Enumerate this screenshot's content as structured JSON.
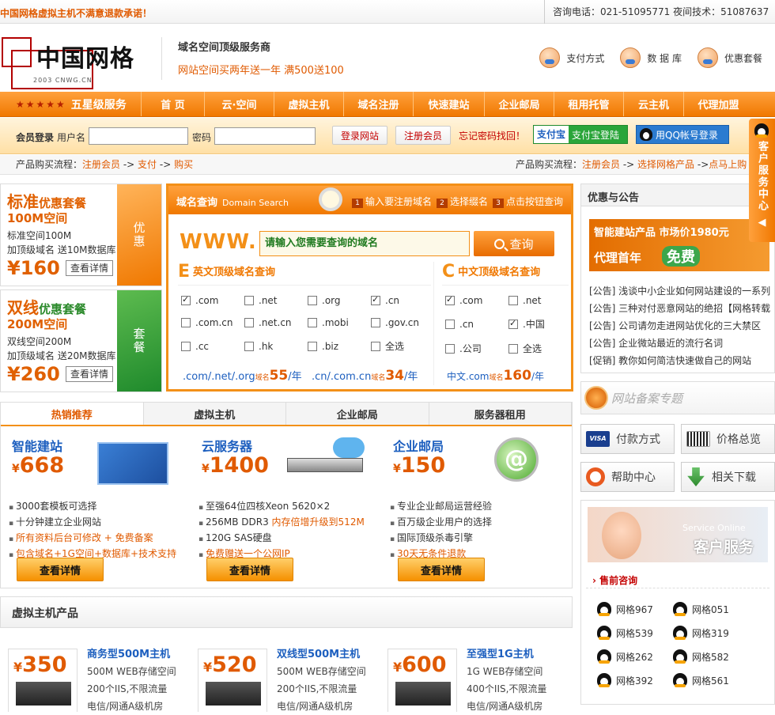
{
  "topbar": {
    "promo": "中国网格虚拟主机不满意退款承诺！",
    "phones": "咨询电话：021-51095771 夜间技术：51087637"
  },
  "logo": {
    "name": "中国网格",
    "sub": "2003 CNWG.CN"
  },
  "slogan": {
    "title": "域名空间顶级服务商",
    "promo": "网站空间买两年送一年 满500送100"
  },
  "quick_links": [
    "支付方式",
    "数 据 库",
    "优惠套餐"
  ],
  "nav": {
    "first": "五星级服务",
    "items": [
      "首 页",
      "云·空间",
      "虚拟主机",
      "域名注册",
      "快速建站",
      "企业邮局",
      "租用托管",
      "云主机",
      "代理加盟"
    ]
  },
  "login": {
    "title": "会员登录",
    "user_label": "用户名",
    "pass_label": "密码",
    "login_btn": "登录网站",
    "register_btn": "注册会员",
    "forget": "忘记密码找回！",
    "alipay_logo": "支付宝",
    "alipay": "支付宝登陆",
    "qq": "用QQ帐号登录"
  },
  "flow": {
    "label": "产品购买流程：",
    "left": [
      "注册会员",
      "支付",
      "购买"
    ],
    "right": [
      "注册会员",
      "选择网格产品",
      "点马上购"
    ]
  },
  "packages": [
    {
      "title": "标准",
      "title_small": "优惠套餐",
      "size": "100M空间",
      "l1": "标准空间100M",
      "l2": "加顶级域名 送10M数据库",
      "price": "¥160",
      "btn": "查看详情",
      "side": "优惠"
    },
    {
      "title": "双线",
      "title_small": "优惠套餐",
      "size": "200M空间",
      "l1": "双线空间200M",
      "l2": "加顶级域名 送20M数据库",
      "price": "¥260",
      "btn": "查看详情",
      "side": "套餐"
    }
  ],
  "domain": {
    "title": "域名查询",
    "title_en": "Domain Search",
    "steps": [
      "输入要注册域名",
      "选择缀名",
      "点击按钮查询"
    ],
    "www": "WWW.",
    "placeholder": "请输入您需要查询的域名",
    "search_btn": "查询",
    "en_big": "E",
    "en_title": "英文顶级域名查询",
    "cn_big": "C",
    "cn_title": "中文顶级域名查询",
    "en_options": [
      {
        "label": ".com",
        "checked": true
      },
      {
        "label": ".net",
        "checked": false
      },
      {
        "label": ".org",
        "checked": false
      },
      {
        "label": ".cn",
        "checked": true
      },
      {
        "label": ".com.cn",
        "checked": false
      },
      {
        "label": ".net.cn",
        "checked": false
      },
      {
        "label": ".mobi",
        "checked": false
      },
      {
        "label": ".gov.cn",
        "checked": false
      },
      {
        "label": ".cc",
        "checked": false
      },
      {
        "label": ".hk",
        "checked": false
      },
      {
        "label": ".biz",
        "checked": false
      },
      {
        "label": "全选",
        "checked": false
      }
    ],
    "cn_options": [
      {
        "label": ".com",
        "checked": true
      },
      {
        "label": ".net",
        "checked": false
      },
      {
        "label": ".cn",
        "checked": false
      },
      {
        "label": ".中国",
        "checked": true
      },
      {
        "label": ".公司",
        "checked": false
      },
      {
        "label": "全选",
        "checked": false
      }
    ],
    "price1_pre": ".com/.net/.org",
    "price1_sfx": "域名",
    "price1": "55",
    "price1_unit": "/年",
    "price2_pre": ".cn/.com.cn",
    "price2_sfx": "域名",
    "price2": "34",
    "price2_unit": "/年",
    "price3_pre": "中文.com",
    "price3_sfx": "域名",
    "price3": "160",
    "price3_unit": "/年"
  },
  "notice": {
    "title": "优惠与公告",
    "banner1": "智能建站产品 市场价1980元",
    "banner2": "代理首年",
    "banner3": "免费",
    "items": [
      "[公告] 浅谈中小企业如何网站建设的一系列",
      "[公告] 三种对付恶意网站的绝招【网格转载",
      "[公告] 公司请勿走进网站优化的三大禁区",
      "[公告] 企业微站最近的流行名词",
      "[促销] 教你如何简洁快速做自己的网站"
    ]
  },
  "beian": "网站备案专题",
  "tiles": [
    "付款方式",
    "价格总览",
    "帮助中心",
    "相关下载"
  ],
  "service": {
    "online": "Service Online",
    "cs": "客户服务",
    "title": "售前咨询",
    "qq": [
      "网格967",
      "网格051",
      "网格539",
      "网格319",
      "网格262",
      "网格582",
      "网格392",
      "网格561"
    ]
  },
  "float": {
    "text": "客户服务中心"
  },
  "hot_tabs": [
    "热销推荐",
    "虚拟主机",
    "企业邮局",
    "服务器租用"
  ],
  "products": [
    {
      "title": "智能建站",
      "price": "668",
      "cur": "¥",
      "btn": "查看详情",
      "items": [
        {
          "t": "3000套模板可选择",
          "o": false
        },
        {
          "t": "十分钟建立企业网站",
          "o": false
        },
        {
          "t": "所有资料后台可修改 + 免费备案",
          "o": true
        },
        {
          "t": "包含域名+1G空间+数据库+技术支持",
          "o": true
        }
      ]
    },
    {
      "title": "云服务器",
      "price": "1400",
      "cur": "¥",
      "btn": "查看详情",
      "items": [
        {
          "t": "至强64位四核Xeon 5620×2",
          "o": false
        },
        {
          "t": "256MB DDR3 ",
          "o": false,
          "extra": "内存倍增升级到512M"
        },
        {
          "t": "120G SAS硬盘",
          "o": false
        },
        {
          "t": "免费赠送一个公网IP",
          "o": true
        }
      ]
    },
    {
      "title": "企业邮局",
      "price": "150",
      "cur": "¥",
      "btn": "查看详情",
      "items": [
        {
          "t": "专业企业邮局运营经验",
          "o": false
        },
        {
          "t": "百万级企业用户的选择",
          "o": false
        },
        {
          "t": "国际顶级杀毒引擎",
          "o": false
        },
        {
          "t": "30天无条件退款",
          "o": true
        }
      ]
    }
  ],
  "virtual": {
    "title": "虚拟主机产品",
    "cards": [
      {
        "price": "350",
        "cur": "¥",
        "name": "商务型500M主机",
        "d1": "500M WEB存储空间",
        "d2": "200个IIS,不限流量",
        "d3": "电信/网通A级机房"
      },
      {
        "price": "520",
        "cur": "¥",
        "name": "双线型500M主机",
        "d1": "500M WEB存储空间",
        "d2": "200个IIS,不限流量",
        "d3": "电信/网通A级机房"
      },
      {
        "price": "600",
        "cur": "¥",
        "name": "至强型1G主机",
        "d1": "1G WEB存储空间",
        "d2": "400个IIS,不限流量",
        "d3": "电信/网通A级机房"
      }
    ]
  }
}
